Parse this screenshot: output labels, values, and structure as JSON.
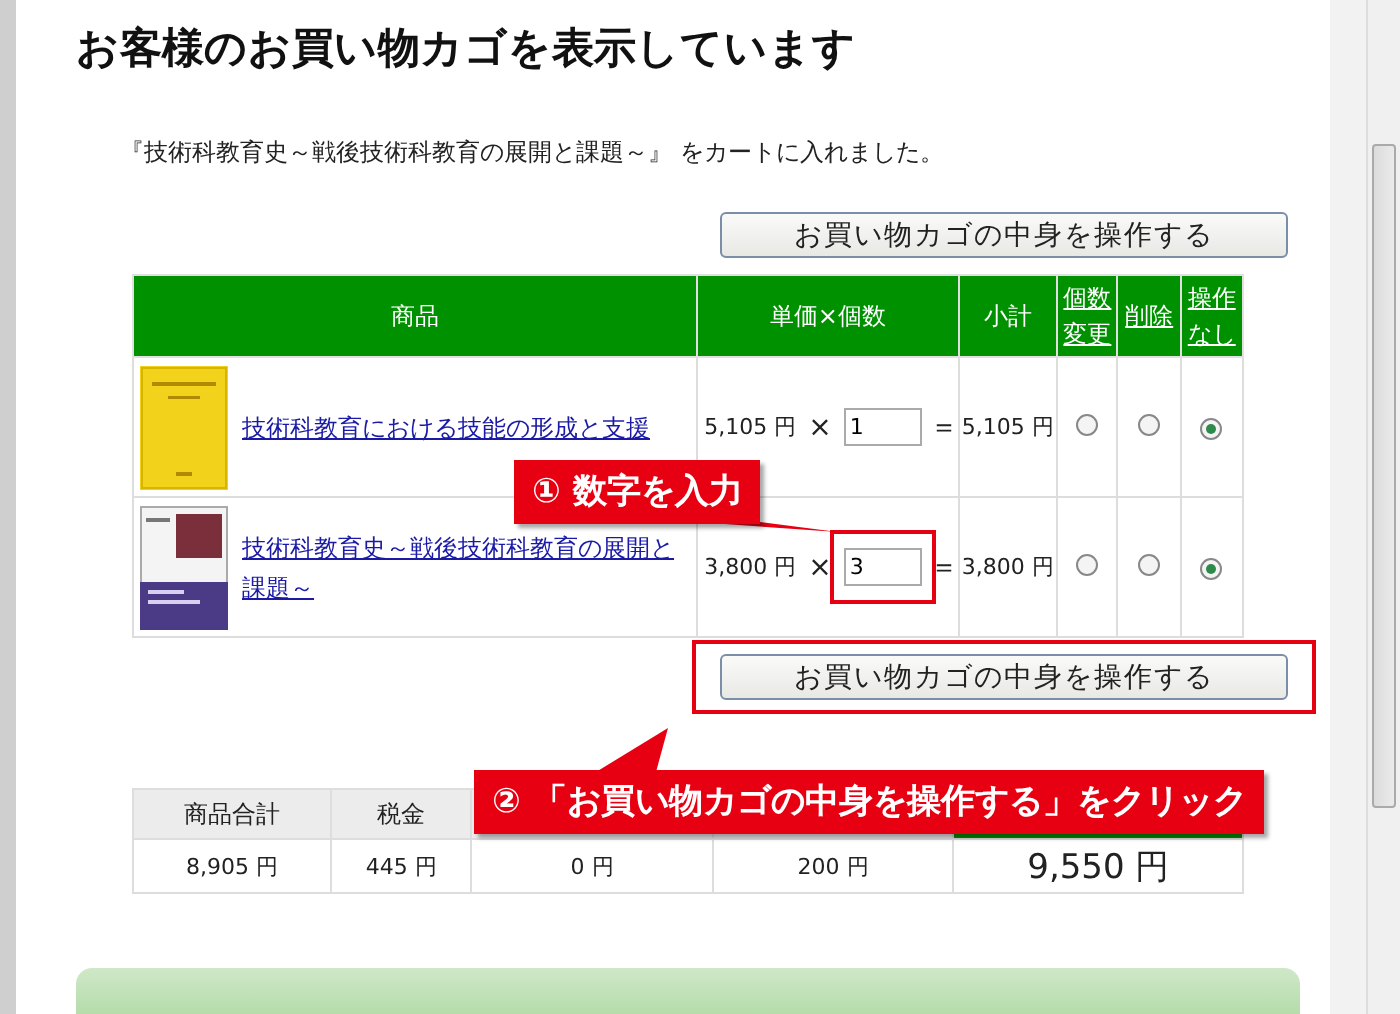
{
  "title": "お客様のお買い物カゴを表示しています",
  "message": "『技術科教育史～戦後技術科教育の展開と課題～』 をカートに入れました。",
  "update_buttons": [
    "お買い物カゴの中身を操作する",
    "お買い物カゴの中身を操作する"
  ],
  "cart": {
    "columns": [
      {
        "label": "商品",
        "link": false
      },
      {
        "label": "単価×個数",
        "link": false
      },
      {
        "label": "小計",
        "link": false
      },
      {
        "label": "個数変更",
        "link": true
      },
      {
        "label": "削除",
        "link": true
      },
      {
        "label": "操作なし",
        "link": true
      }
    ],
    "rows": [
      {
        "title": "技術科教育における技能の形成と支援",
        "price": "5,105 円",
        "times": "×",
        "quantity": "1",
        "equals": "＝",
        "subtotal": "5,105 円",
        "actions": [
          {
            "selected": false
          },
          {
            "selected": false
          },
          {
            "selected": true
          }
        ]
      },
      {
        "title": "技術科教育史～戦後技術科教育の展開と課題～",
        "price": "3,800 円",
        "times": "×",
        "quantity": "3",
        "equals": "＝",
        "subtotal": "3,800 円",
        "actions": [
          {
            "selected": false
          },
          {
            "selected": false
          },
          {
            "selected": true
          }
        ]
      }
    ]
  },
  "summary": {
    "columns": [
      "商品合計",
      "税金"
    ],
    "values": [
      "8,905 円",
      "445 円",
      "0 円",
      "200 円",
      "9,550 円"
    ]
  },
  "callouts": [
    {
      "text": "① 数字を入力"
    },
    {
      "text": "② 「お買い物カゴの中身を操作する」をクリック"
    }
  ]
}
